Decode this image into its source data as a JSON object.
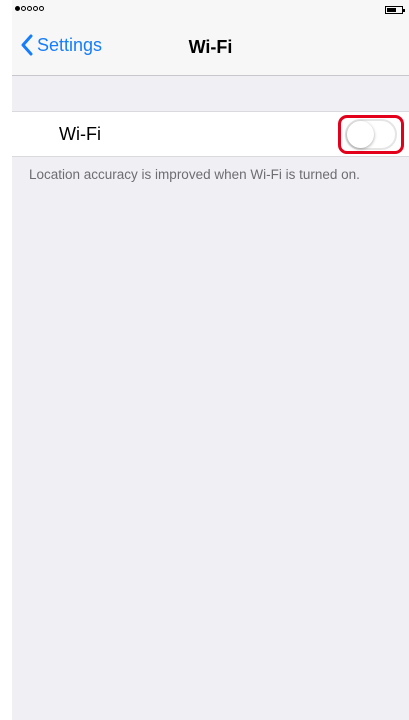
{
  "status_bar": {
    "signal_dots": [
      true,
      false,
      false,
      false,
      false
    ]
  },
  "nav": {
    "back_label": "Settings",
    "title": "Wi-Fi"
  },
  "wifi_row": {
    "label": "Wi-Fi",
    "toggle_on": false
  },
  "footer": {
    "note": "Location accuracy is improved when Wi-Fi is turned on."
  },
  "colors": {
    "accent": "#157efb",
    "highlight": "#e2001a",
    "background": "#efeff4"
  },
  "icons": {
    "back": "chevron-left-icon",
    "battery": "battery-icon",
    "signal": "signal-dots-icon"
  }
}
